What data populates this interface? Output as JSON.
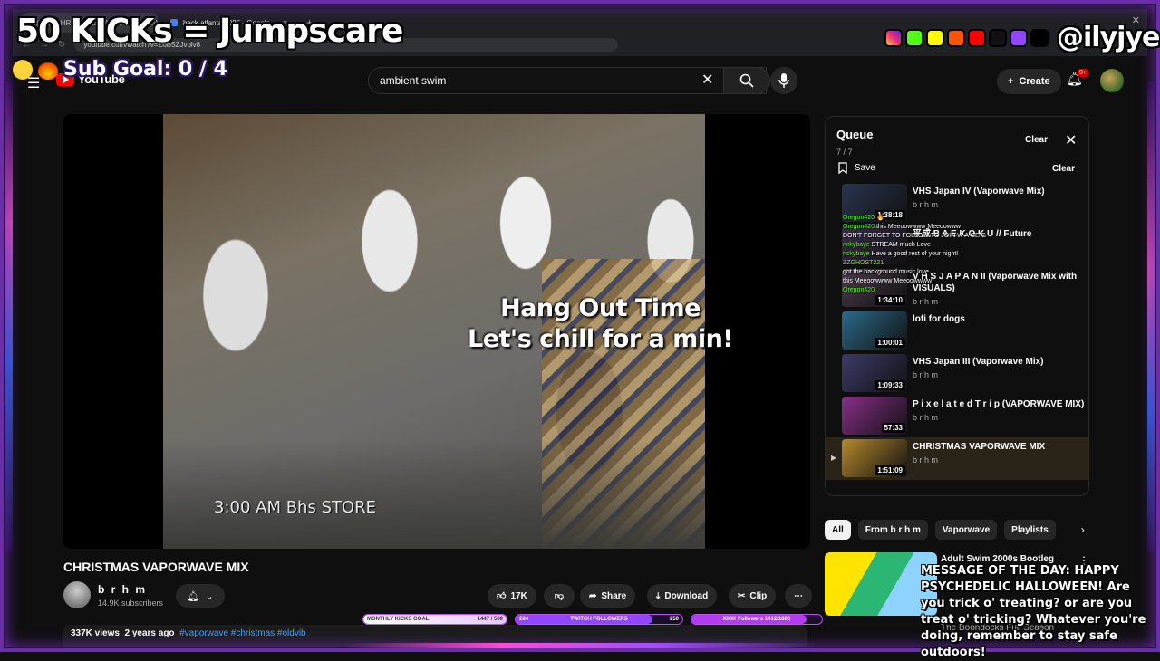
{
  "browser": {
    "tabs": [
      {
        "title": "(136) CHRISTMAS VAPORWAVE MIX"
      },
      {
        "title": "back atlanta 2025 - Google"
      }
    ],
    "url": "youtube.com/watch?v=ZoB5ZJvolv8"
  },
  "youtube": {
    "logo": "YouTube",
    "search_value": "ambient swim",
    "create_label": "Create",
    "notif_count": "9+"
  },
  "player": {
    "overlay_line1": "Hang Out Time",
    "overlay_line2": "Let's chill for a min!",
    "caption": "3:00 AM Bhs STORE"
  },
  "video": {
    "title": "CHRISTMAS VAPORWAVE MIX",
    "channel": "b r h m",
    "subscribers": "14.9K subscribers",
    "likes": "17K",
    "share": "Share",
    "download": "Download",
    "clip": "Clip",
    "views": "337K views",
    "age": "2 years ago",
    "tags": "#vaporwave #christmas #oldvib"
  },
  "queue": {
    "title": "Queue",
    "count": "7 / 7",
    "clear": "Clear",
    "save": "Save",
    "items": [
      {
        "title": "VHS Japan IV (Vaporwave Mix)",
        "channel": "b r h m",
        "duration": "1:38:18",
        "thumb": "#2a3550"
      },
      {
        "title": "平成 B A E K O K U // Future",
        "channel": "",
        "duration": "",
        "thumb": "#3a2b4a"
      },
      {
        "title": "V H S  J A P A N II (Vaporwave Mix with VISUALS)",
        "channel": "b r h m",
        "duration": "1:34:10",
        "thumb": "#4a3a4a"
      },
      {
        "title": "lofi for dogs",
        "channel": "",
        "duration": "1:00:01",
        "thumb": "#2c6a8a"
      },
      {
        "title": "VHS Japan III (Vaporwave Mix)",
        "channel": "b r h m",
        "duration": "1:09:33",
        "thumb": "#3b3b6a"
      },
      {
        "title": "P i x e l a t e d T r i p (VAPORWAVE MIX)",
        "channel": "b r h m",
        "duration": "57:33",
        "thumb": "#8a2f8a"
      },
      {
        "title": "CHRISTMAS VAPORWAVE MIX",
        "channel": "b r h m",
        "duration": "1:51:09",
        "thumb": "#b7892c"
      }
    ]
  },
  "chips": [
    "All",
    "From b r h m",
    "Vaporwave",
    "Playlists"
  ],
  "related": {
    "title": "Adult Swim 2000s Bootleg",
    "subtitle": "The Boondocks Full Season"
  },
  "stream": {
    "kicks_goal": "50 KICKs = Jumpscare",
    "sub_goal": "Sub Goal:  0 / 4",
    "handle": "@ilyjye",
    "motd": "MESSAGE OF THE DAY: HAPPY PSYCHEDELIC HALLOWEEN! Are you trick o' treating? or are you treat o' tricking? Whatever you're doing, remember to stay safe outdoors!",
    "goal_monthly_label": "MONTHLY KICKS GOAL:",
    "goal_monthly_value": "1447 / 500",
    "goal_twitch_label": "TWITCH FOLLOWERS",
    "goal_twitch_left": "204",
    "goal_twitch_right": "250",
    "goal_kick_label": "KICK Followers 1412/1600",
    "chat": [
      {
        "user": "Oregon420",
        "msg": "🔥"
      },
      {
        "user": "Oregon420",
        "msg": "this Meeoowwww Meeoowww"
      },
      {
        "user": "",
        "msg": "DON'T FORGET TO FOLLOW TO JOIN W A GE G"
      },
      {
        "user": "rickybaye",
        "msg": "STREAM much Love"
      },
      {
        "user": "rickybaye",
        "msg": "Have a good rest of your night!"
      },
      {
        "user": "ZZGHOST221",
        "msg": ""
      },
      {
        "user": "",
        "msg": "got the background music love"
      },
      {
        "user": "",
        "msg": "this Meeoowwww Meeoowwww"
      },
      {
        "user": "Oregon420",
        "msg": ""
      }
    ]
  },
  "colors": {
    "accent_red": "#ff0000",
    "kick_green": "#53fc18",
    "twitch_purple": "#9146ff",
    "frame_purple": "#6a2ea8"
  }
}
